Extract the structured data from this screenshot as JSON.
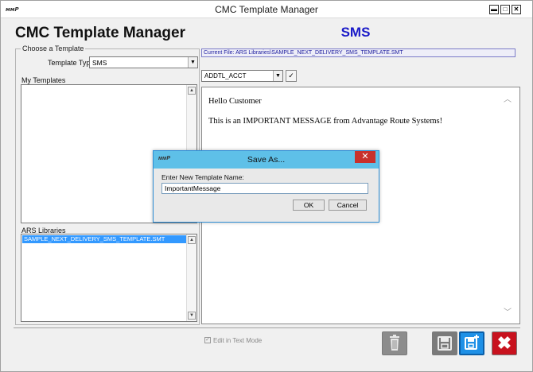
{
  "window": {
    "title": "CMC Template Manager",
    "icon_text": "ᴍᴍP",
    "minimize": "▬",
    "maximize": "□",
    "close": "✕"
  },
  "header": {
    "app_title": "CMC Template Manager",
    "mode": "SMS",
    "mode_color": "#1a1ac8"
  },
  "choose": {
    "legend": "Choose a Template",
    "template_type_label": "Template Type",
    "template_type_value": "SMS",
    "my_templates_label": "My Templates",
    "ars_libraries_label": "ARS Libraries",
    "ars_items": [
      "SAMPLE_NEXT_DELIVERY_SMS_TEMPLATE.SMT"
    ]
  },
  "editor": {
    "current_file": "Current File: ARS Libraries\\SAMPLE_NEXT_DELIVERY_SMS_TEMPLATE.SMT",
    "field_value": "ADDTL_ACCT",
    "insert_glyph": "✓",
    "line1": "Hello Customer",
    "line2": "This is an IMPORTANT MESSAGE from Advantage Route Systems!"
  },
  "footer": {
    "edit_in_text_mode_label": "Edit in Text Mode",
    "edit_in_text_mode_checked": true,
    "close_glyph": "✖"
  },
  "dialog": {
    "title": "Save As...",
    "prompt": "Enter New Template Name:",
    "value": "ImportantMessage",
    "ok_label": "OK",
    "cancel_label": "Cancel",
    "close_glyph": "✕"
  },
  "colors": {
    "selection": "#3399ff",
    "dialog_title": "#5ec0e8",
    "close_red": "#c8121e",
    "saveas_blue": "#1e90e6"
  }
}
